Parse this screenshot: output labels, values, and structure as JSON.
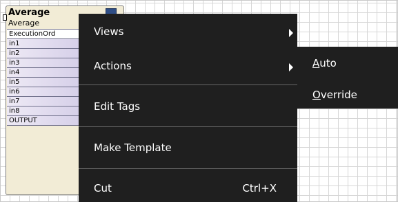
{
  "block": {
    "title": "Average",
    "subtitle": "Average",
    "slots": [
      "ExecutionOrd",
      "in1",
      "in2",
      "in3",
      "in4",
      "in5",
      "in6",
      "in7",
      "in8",
      "OUTPUT"
    ]
  },
  "menu": {
    "views": "Views",
    "actions": "Actions",
    "edit_tags": "Edit Tags",
    "make_template": "Make Template",
    "cut": "Cut",
    "cut_shortcut": "Ctrl+X"
  },
  "submenu": {
    "auto_first": "A",
    "auto_rest": "uto",
    "override_first": "O",
    "override_rest": "verride"
  },
  "colors": {
    "menu_bg": "#1f1f1f",
    "block_bg": "#f2ecd6",
    "slot_gradient_end": "#c8c0e2"
  }
}
